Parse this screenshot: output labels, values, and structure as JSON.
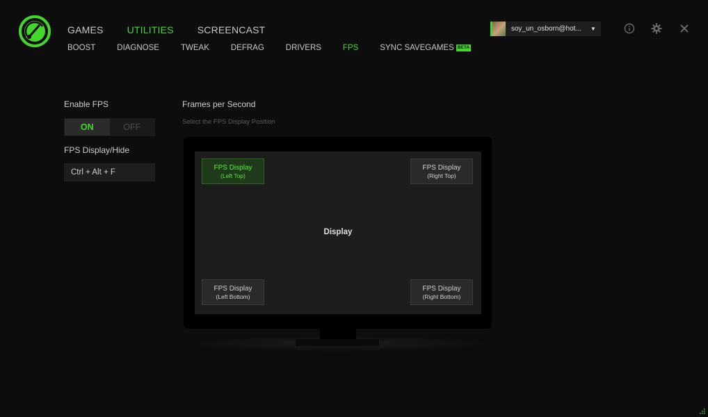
{
  "top_nav": [
    "GAMES",
    "UTILITIES",
    "SCREENCAST"
  ],
  "sub_nav": [
    "BOOST",
    "DIAGNOSE",
    "TWEAK",
    "DEFRAG",
    "DRIVERS",
    "FPS",
    "SYNC SAVEGAMES"
  ],
  "beta_badge": "BETA",
  "account": {
    "email": "soy_un_osborn@hot..."
  },
  "enable_fps": {
    "label": "Enable FPS",
    "on": "ON",
    "off": "OFF"
  },
  "hotkey": {
    "label": "FPS Display/Hide",
    "value": "Ctrl + Alt + F"
  },
  "fps_section": {
    "title": "Frames per Second",
    "subtitle": "Select the FPS Display Position",
    "display_label": "Display",
    "positions": [
      {
        "title": "FPS Display",
        "sub": "(Left Top)"
      },
      {
        "title": "FPS Display",
        "sub": "(Right Top)"
      },
      {
        "title": "FPS Display",
        "sub": "(Left Bottom)"
      },
      {
        "title": "FPS Display",
        "sub": "(Right Bottom)"
      }
    ]
  },
  "colors": {
    "accent": "#44d62c",
    "background": "#0d0d0d",
    "panel": "#1d1d1d"
  },
  "icons": [
    "speedometer-logo",
    "info-icon",
    "gear-icon",
    "close-icon",
    "caret-down-icon",
    "resize-grip-icon"
  ]
}
